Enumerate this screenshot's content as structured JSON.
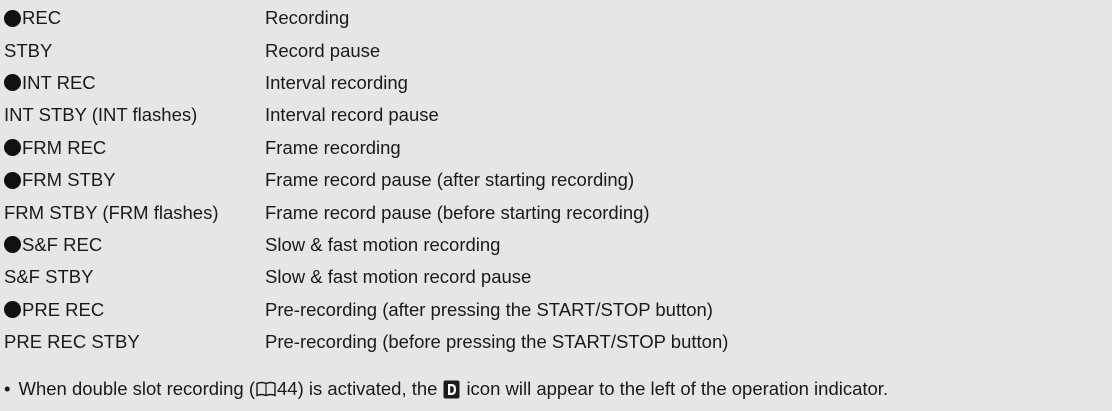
{
  "rows": [
    {
      "dot": true,
      "indicator": "REC",
      "meaning": "Recording"
    },
    {
      "dot": false,
      "indicator": "STBY",
      "meaning": "Record pause"
    },
    {
      "dot": true,
      "indicator": "INT REC",
      "meaning": "Interval recording"
    },
    {
      "dot": false,
      "indicator": "INT STBY (INT flashes)",
      "meaning": "Interval record pause"
    },
    {
      "dot": true,
      "indicator": "FRM REC",
      "meaning": "Frame recording"
    },
    {
      "dot": true,
      "indicator": "FRM STBY",
      "meaning": "Frame record pause (after starting recording)"
    },
    {
      "dot": false,
      "indicator": "FRM STBY (FRM flashes)",
      "meaning": "Frame record pause (before starting recording)"
    },
    {
      "dot": true,
      "indicator": "S&F REC",
      "meaning": "Slow & fast motion recording"
    },
    {
      "dot": false,
      "indicator": "S&F STBY",
      "meaning": "Slow & fast motion record pause"
    },
    {
      "dot": true,
      "indicator": "PRE REC",
      "meaning": "Pre-recording (after pressing the START/STOP button)"
    },
    {
      "dot": false,
      "indicator": "PRE REC STBY",
      "meaning": "Pre-recording (before pressing the START/STOP button)"
    }
  ],
  "note": {
    "bullet": "•",
    "text_before": "When double slot recording (",
    "page_ref": " 44",
    "text_middle": ") is activated, the",
    "text_after": "icon will appear to the left of the operation indicator.",
    "ref_icon": "book-reference-icon",
    "slot_icon": "double-slot-recording-icon"
  },
  "colors": {
    "background": "#e6e6e6",
    "text": "#1a1a1a",
    "dot": "#111111"
  }
}
